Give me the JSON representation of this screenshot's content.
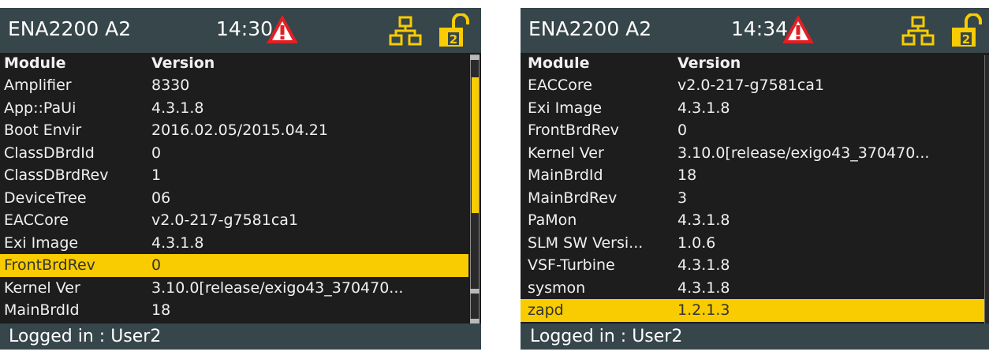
{
  "colors": {
    "titlebar": "#36464b",
    "background": "#1d1d1d",
    "highlight": "#f8cc00",
    "warning": "#e21f23"
  },
  "screens": [
    {
      "device": "ENA2200 A2",
      "time": "14:30",
      "icons": [
        "warning-icon",
        "network-icon",
        "unlocked-level-2-icon"
      ],
      "lock_level": "2",
      "headers": {
        "module": "Module",
        "version": "Version"
      },
      "rows": [
        {
          "module": "Amplifier",
          "version": "8330"
        },
        {
          "module": "App::PaUi",
          "version": "4.3.1.8"
        },
        {
          "module": "Boot Envir",
          "version": "2016.02.05/2015.04.21"
        },
        {
          "module": "ClassDBrdId",
          "version": "0"
        },
        {
          "module": "ClassDBrdRev",
          "version": "1"
        },
        {
          "module": "DeviceTree",
          "version": "06"
        },
        {
          "module": "EACCore",
          "version": "v2.0-217-g7581ca1"
        },
        {
          "module": "Exi Image",
          "version": "4.3.1.8"
        },
        {
          "module": "FrontBrdRev",
          "version": "0",
          "selected": true
        },
        {
          "module": "Kernel Ver",
          "version": "3.10.0[release/exigo43_370470..."
        },
        {
          "module": "MainBrdId",
          "version": "18"
        }
      ],
      "login": "Logged in : User2"
    },
    {
      "device": "ENA2200 A2",
      "time": "14:34",
      "icons": [
        "warning-icon",
        "network-icon",
        "unlocked-level-2-icon"
      ],
      "lock_level": "2",
      "headers": {
        "module": "Module",
        "version": "Version"
      },
      "rows": [
        {
          "module": "EACCore",
          "version": "v2.0-217-g7581ca1"
        },
        {
          "module": "Exi Image",
          "version": "4.3.1.8"
        },
        {
          "module": "FrontBrdRev",
          "version": "0"
        },
        {
          "module": "Kernel Ver",
          "version": "3.10.0[release/exigo43_370470..."
        },
        {
          "module": "MainBrdId",
          "version": "18"
        },
        {
          "module": "MainBrdRev",
          "version": "3"
        },
        {
          "module": "PaMon",
          "version": "4.3.1.8"
        },
        {
          "module": "SLM SW Versi...",
          "version": "1.0.6"
        },
        {
          "module": "VSF-Turbine",
          "version": "4.3.1.8"
        },
        {
          "module": "sysmon",
          "version": "4.3.1.8"
        },
        {
          "module": "zapd",
          "version": "1.2.1.3",
          "selected": true
        }
      ],
      "login": "Logged in : User2"
    }
  ]
}
